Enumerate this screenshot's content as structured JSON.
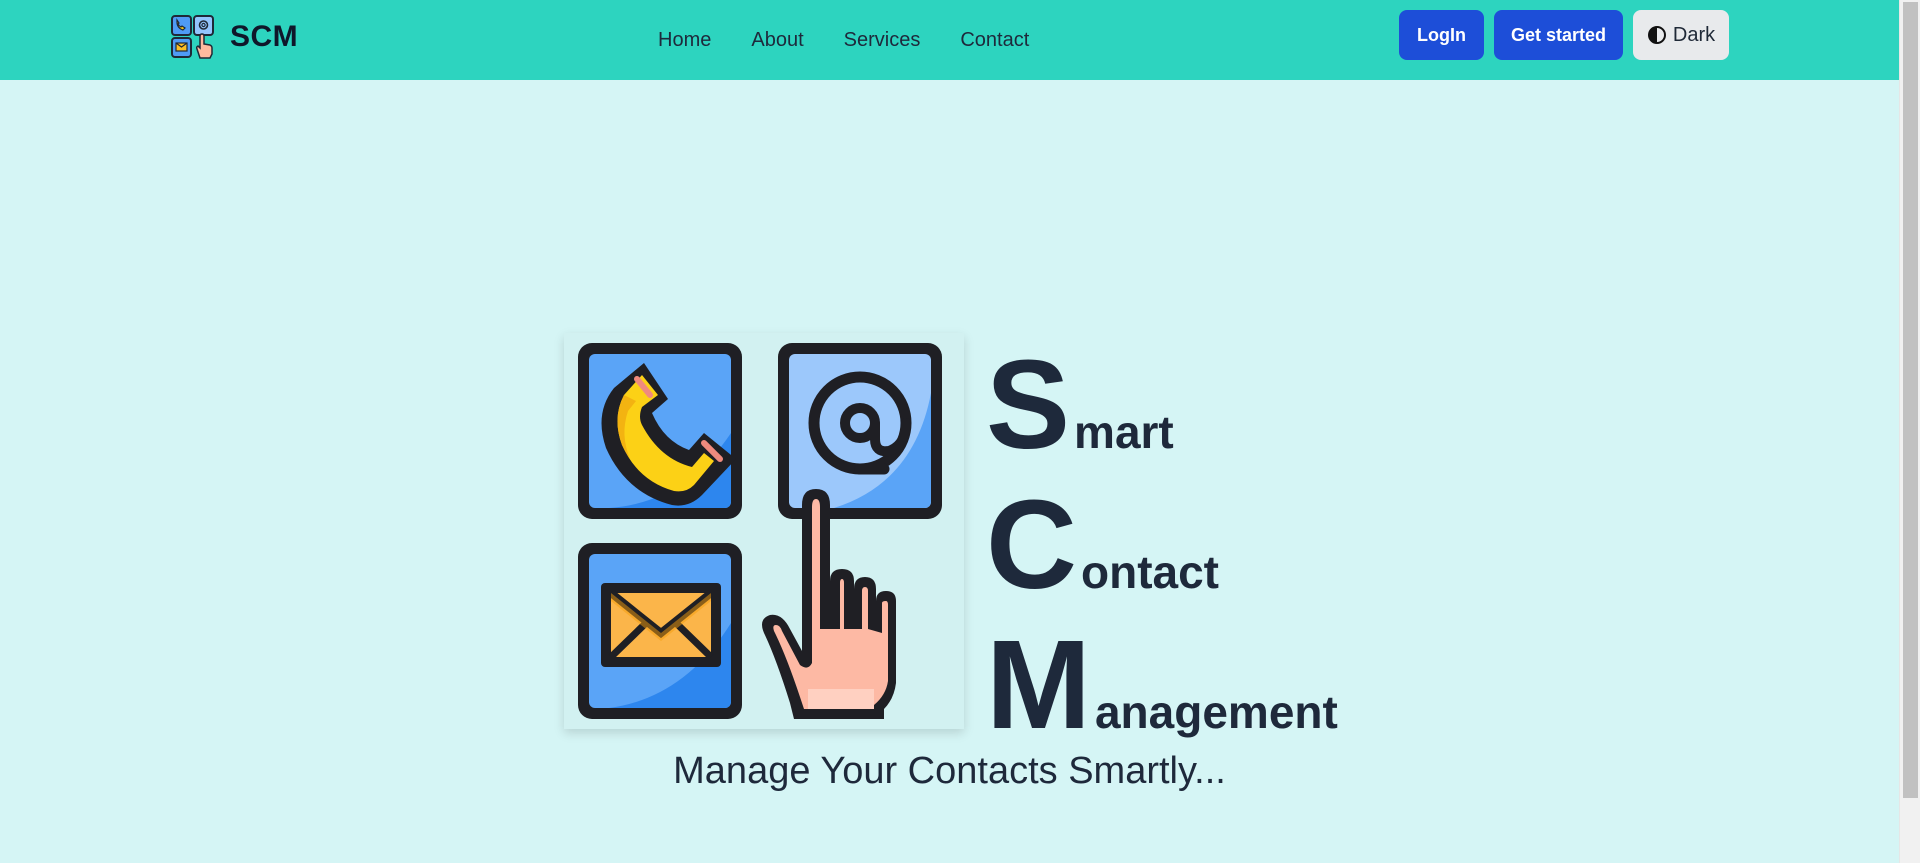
{
  "brand": {
    "name": "SCM",
    "logo_icon": "contact-tiles-logo-icon"
  },
  "nav": {
    "links": [
      {
        "label": "Home"
      },
      {
        "label": "About"
      },
      {
        "label": "Services"
      },
      {
        "label": "Contact"
      }
    ]
  },
  "actions": {
    "login_label": "LogIn",
    "get_started_label": "Get started",
    "theme_label": "Dark",
    "theme_icon": "half-circle-contrast-icon"
  },
  "hero": {
    "logo_icon": "phone-email-mail-pointer-logo-icon",
    "words": [
      {
        "initial": "S",
        "rest": "mart"
      },
      {
        "initial": "C",
        "rest": "ontact"
      },
      {
        "initial": "M",
        "rest": "anagement"
      }
    ],
    "tagline": "Manage Your Contacts Smartly..."
  },
  "colors": {
    "navbar": "#2dd4bf",
    "page_background": "#d5f5f5",
    "primary_button": "#1d4ed8",
    "text": "#1e293b"
  }
}
